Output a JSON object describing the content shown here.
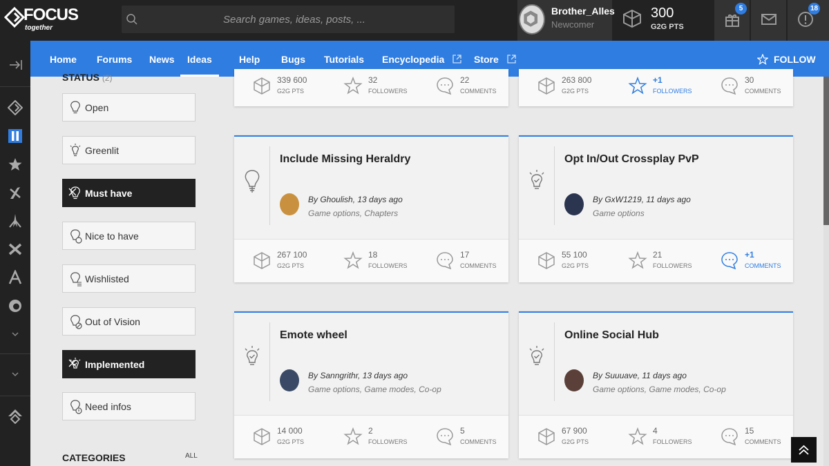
{
  "header": {
    "logo_text": "FOCUS",
    "logo_sub": "together",
    "search_placeholder": "Search games, ideas, posts, ...",
    "user": {
      "name": "Brother_Alles",
      "rank": "Newcomer"
    },
    "points": {
      "value": "300",
      "label": "G2G PTS"
    },
    "gift_badge": "5",
    "alerts_badge": "18"
  },
  "nav": {
    "items": [
      "Home",
      "Forums",
      "News",
      "Ideas",
      "Help",
      "Bugs",
      "Tutorials",
      "Encyclopedia",
      "Store"
    ],
    "active": "Ideas",
    "follow_label": "FOLLOW"
  },
  "filters": {
    "status_title": "STATUS",
    "status_count": "(2)",
    "items": [
      {
        "label": "Open",
        "selected": false
      },
      {
        "label": "Greenlit",
        "selected": false
      },
      {
        "label": "Must have",
        "selected": true
      },
      {
        "label": "Nice to have",
        "selected": false
      },
      {
        "label": "Wishlisted",
        "selected": false
      },
      {
        "label": "Out of Vision",
        "selected": false
      },
      {
        "label": "Implemented",
        "selected": true
      },
      {
        "label": "Need infos",
        "selected": false
      }
    ],
    "categories_title": "CATEGORIES",
    "categories_all": "ALL"
  },
  "cards_partial": [
    {
      "pts": "339 600",
      "pts_label": "G2G PTS",
      "followers": "32",
      "followers_label": "FOLLOWERS",
      "comments": "22",
      "comments_label": "COMMENTS"
    },
    {
      "pts": "263 800",
      "pts_label": "G2G PTS",
      "followers": "+1",
      "followers_label": "FOLLOWERS",
      "comments": "30",
      "comments_label": "COMMENTS"
    }
  ],
  "cards": [
    {
      "title": "Include Missing Heraldry",
      "by": "By Ghoulish, 13 days ago",
      "tags": "Game options, Chapters",
      "pts": "267 100",
      "pts_label": "G2G PTS",
      "followers": "18",
      "followers_label": "FOLLOWERS",
      "comments": "17",
      "comments_label": "COMMENTS"
    },
    {
      "title": "Opt In/Out Crossplay PvP",
      "by": "By GxW1219, 11 days ago",
      "tags": "Game options",
      "pts": "55 100",
      "pts_label": "G2G PTS",
      "followers": "21",
      "followers_label": "FOLLOWERS",
      "comments": "+1",
      "comments_label": "COMMENTS"
    },
    {
      "title": "Emote wheel",
      "by": "By Sanngrithr, 13 days ago",
      "tags": "Game options, Game modes, Co-op",
      "pts": "14 000",
      "pts_label": "G2G PTS",
      "followers": "2",
      "followers_label": "FOLLOWERS",
      "comments": "5",
      "comments_label": "COMMENTS"
    },
    {
      "title": "Online Social Hub",
      "by": "By Suuuave, 11 days ago",
      "tags": "Game options, Game modes, Co-op",
      "pts": "67 900",
      "pts_label": "G2G PTS",
      "followers": "4",
      "followers_label": "FOLLOWERS",
      "comments": "15",
      "comments_label": "COMMENTS"
    }
  ],
  "colors": {
    "accent": "#2f7de1",
    "header_bg": "#222222",
    "page_bg": "#e9e9e9"
  }
}
